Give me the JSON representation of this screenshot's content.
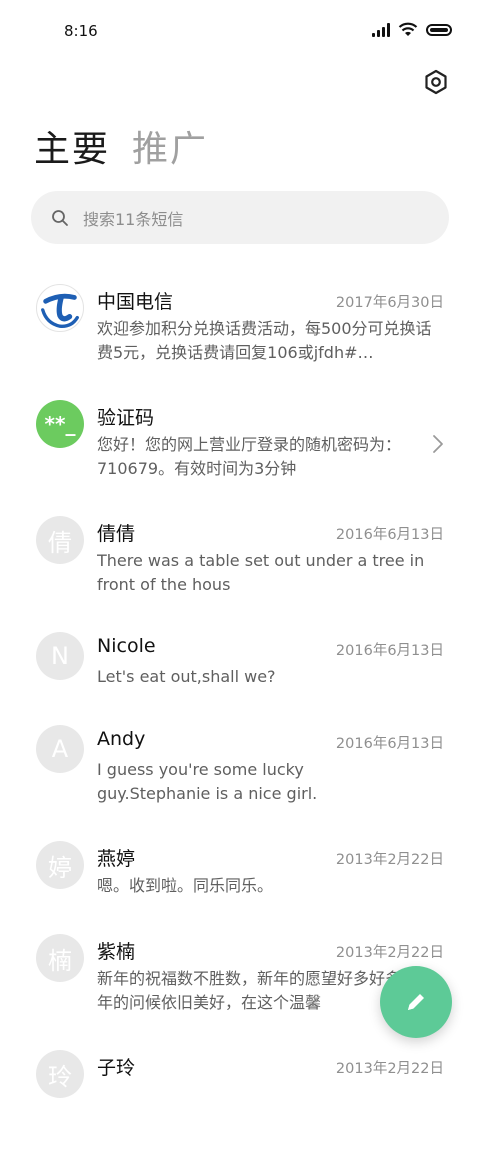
{
  "status": {
    "time": "8:16"
  },
  "tabs": [
    {
      "label": "主要",
      "active": true
    },
    {
      "label": "推广",
      "active": false
    }
  ],
  "search": {
    "placeholder": "搜索11条短信"
  },
  "conversations": [
    {
      "name": "中国电信",
      "date": "2017年6月30日",
      "preview": "欢迎参加积分兑换话费活动，每500分可兑换话费5元，兑换话费请回复106或jfdh#…",
      "avatar": "china-telecom-logo"
    },
    {
      "name": "验证码",
      "date": "",
      "preview": "您好！您的网上营业厅登录的随机密码为：710679。有效时间为3分钟",
      "avatar_text": "**_",
      "avatar_color": "#6ccb5f"
    },
    {
      "name": "倩倩",
      "date": "2016年6月13日",
      "preview": "There was a table set out under a tree in front of the hous",
      "avatar_text": "倩"
    },
    {
      "name": "Nicole",
      "date": "2016年6月13日",
      "preview": "Let's eat out,shall we?",
      "avatar_text": "N"
    },
    {
      "name": "Andy",
      "date": "2016年6月13日",
      "preview": "I guess you're some lucky guy.Stephanie is a nice girl.",
      "avatar_text": "A"
    },
    {
      "name": "燕婷",
      "date": "2013年2月22日",
      "preview": "嗯。收到啦。同乐同乐。",
      "avatar_text": "婷"
    },
    {
      "name": "紫楠",
      "date": "2013年2月22日",
      "preview": "新年的祝福数不胜数，新年的愿望好多好多，新年的问候依旧美好，在这个温馨",
      "avatar_text": "楠"
    },
    {
      "name": "子玲",
      "date": "2013年2月22日",
      "preview": "",
      "avatar_text": "玲"
    }
  ],
  "colors": {
    "accent": "#5dca97",
    "verify_avatar": "#6ccb5f",
    "telecom_blue": "#1e5fb4"
  },
  "icons": {
    "settings": "gear-hex-icon",
    "search": "search-icon",
    "compose": "pencil-icon",
    "chevron": "chevron-right-icon"
  }
}
